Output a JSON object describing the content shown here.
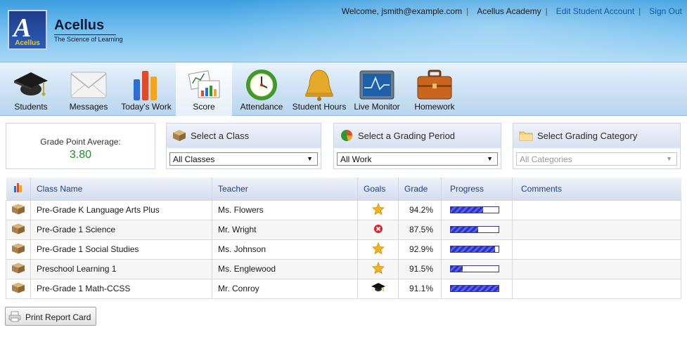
{
  "header": {
    "brand_name": "Acellus",
    "brand_tagline": "The Science of Learning",
    "logo_text": "Acellus",
    "welcome": "Welcome, jsmith@example.com",
    "school": "Acellus Academy",
    "edit_account": "Edit Student Account",
    "sign_out": "Sign Out"
  },
  "toolbar": {
    "items": [
      {
        "label": "Students",
        "icon": "graduation-cap-icon"
      },
      {
        "label": "Messages",
        "icon": "envelope-icon"
      },
      {
        "label": "Today's Work",
        "icon": "bar-chart-icon"
      },
      {
        "label": "Score",
        "icon": "score-chart-icon",
        "active": true
      },
      {
        "label": "Attendance",
        "icon": "clock-icon"
      },
      {
        "label": "Student Hours",
        "icon": "bell-icon"
      },
      {
        "label": "Live Monitor",
        "icon": "monitor-icon"
      },
      {
        "label": "Homework",
        "icon": "briefcase-icon"
      }
    ]
  },
  "gpa": {
    "label": "Grade Point Average:",
    "value": "3.80"
  },
  "filters": {
    "class": {
      "title": "Select a Class",
      "value": "All Classes"
    },
    "period": {
      "title": "Select a Grading Period",
      "value": "All Work"
    },
    "category": {
      "title": "Select Grading Category",
      "value": "All Categories"
    }
  },
  "table": {
    "headers": [
      "Class Name",
      "Teacher",
      "Goals",
      "Grade",
      "Progress",
      "Comments"
    ],
    "rows": [
      {
        "class": "Pre-Grade K Language Arts Plus",
        "teacher": "Ms. Flowers",
        "goal": "star-icon",
        "grade": "94.2%",
        "progress": 0.68,
        "comments": ""
      },
      {
        "class": "Pre-Grade 1 Science",
        "teacher": "Mr. Wright",
        "goal": "error-icon",
        "grade": "87.5%",
        "progress": 0.58,
        "comments": ""
      },
      {
        "class": "Pre-Grade 1 Social Studies",
        "teacher": "Ms. Johnson",
        "goal": "star-icon",
        "grade": "92.9%",
        "progress": 0.93,
        "comments": ""
      },
      {
        "class": "Preschool Learning 1",
        "teacher": "Ms. Englewood",
        "goal": "star-icon",
        "grade": "91.5%",
        "progress": 0.25,
        "comments": ""
      },
      {
        "class": "Pre-Grade 1 Math-CCSS",
        "teacher": "Mr. Conroy",
        "goal": "graduation-cap-icon",
        "grade": "91.1%",
        "progress": 1.0,
        "comments": ""
      }
    ]
  },
  "print_button": {
    "label": "Print Report Card"
  }
}
